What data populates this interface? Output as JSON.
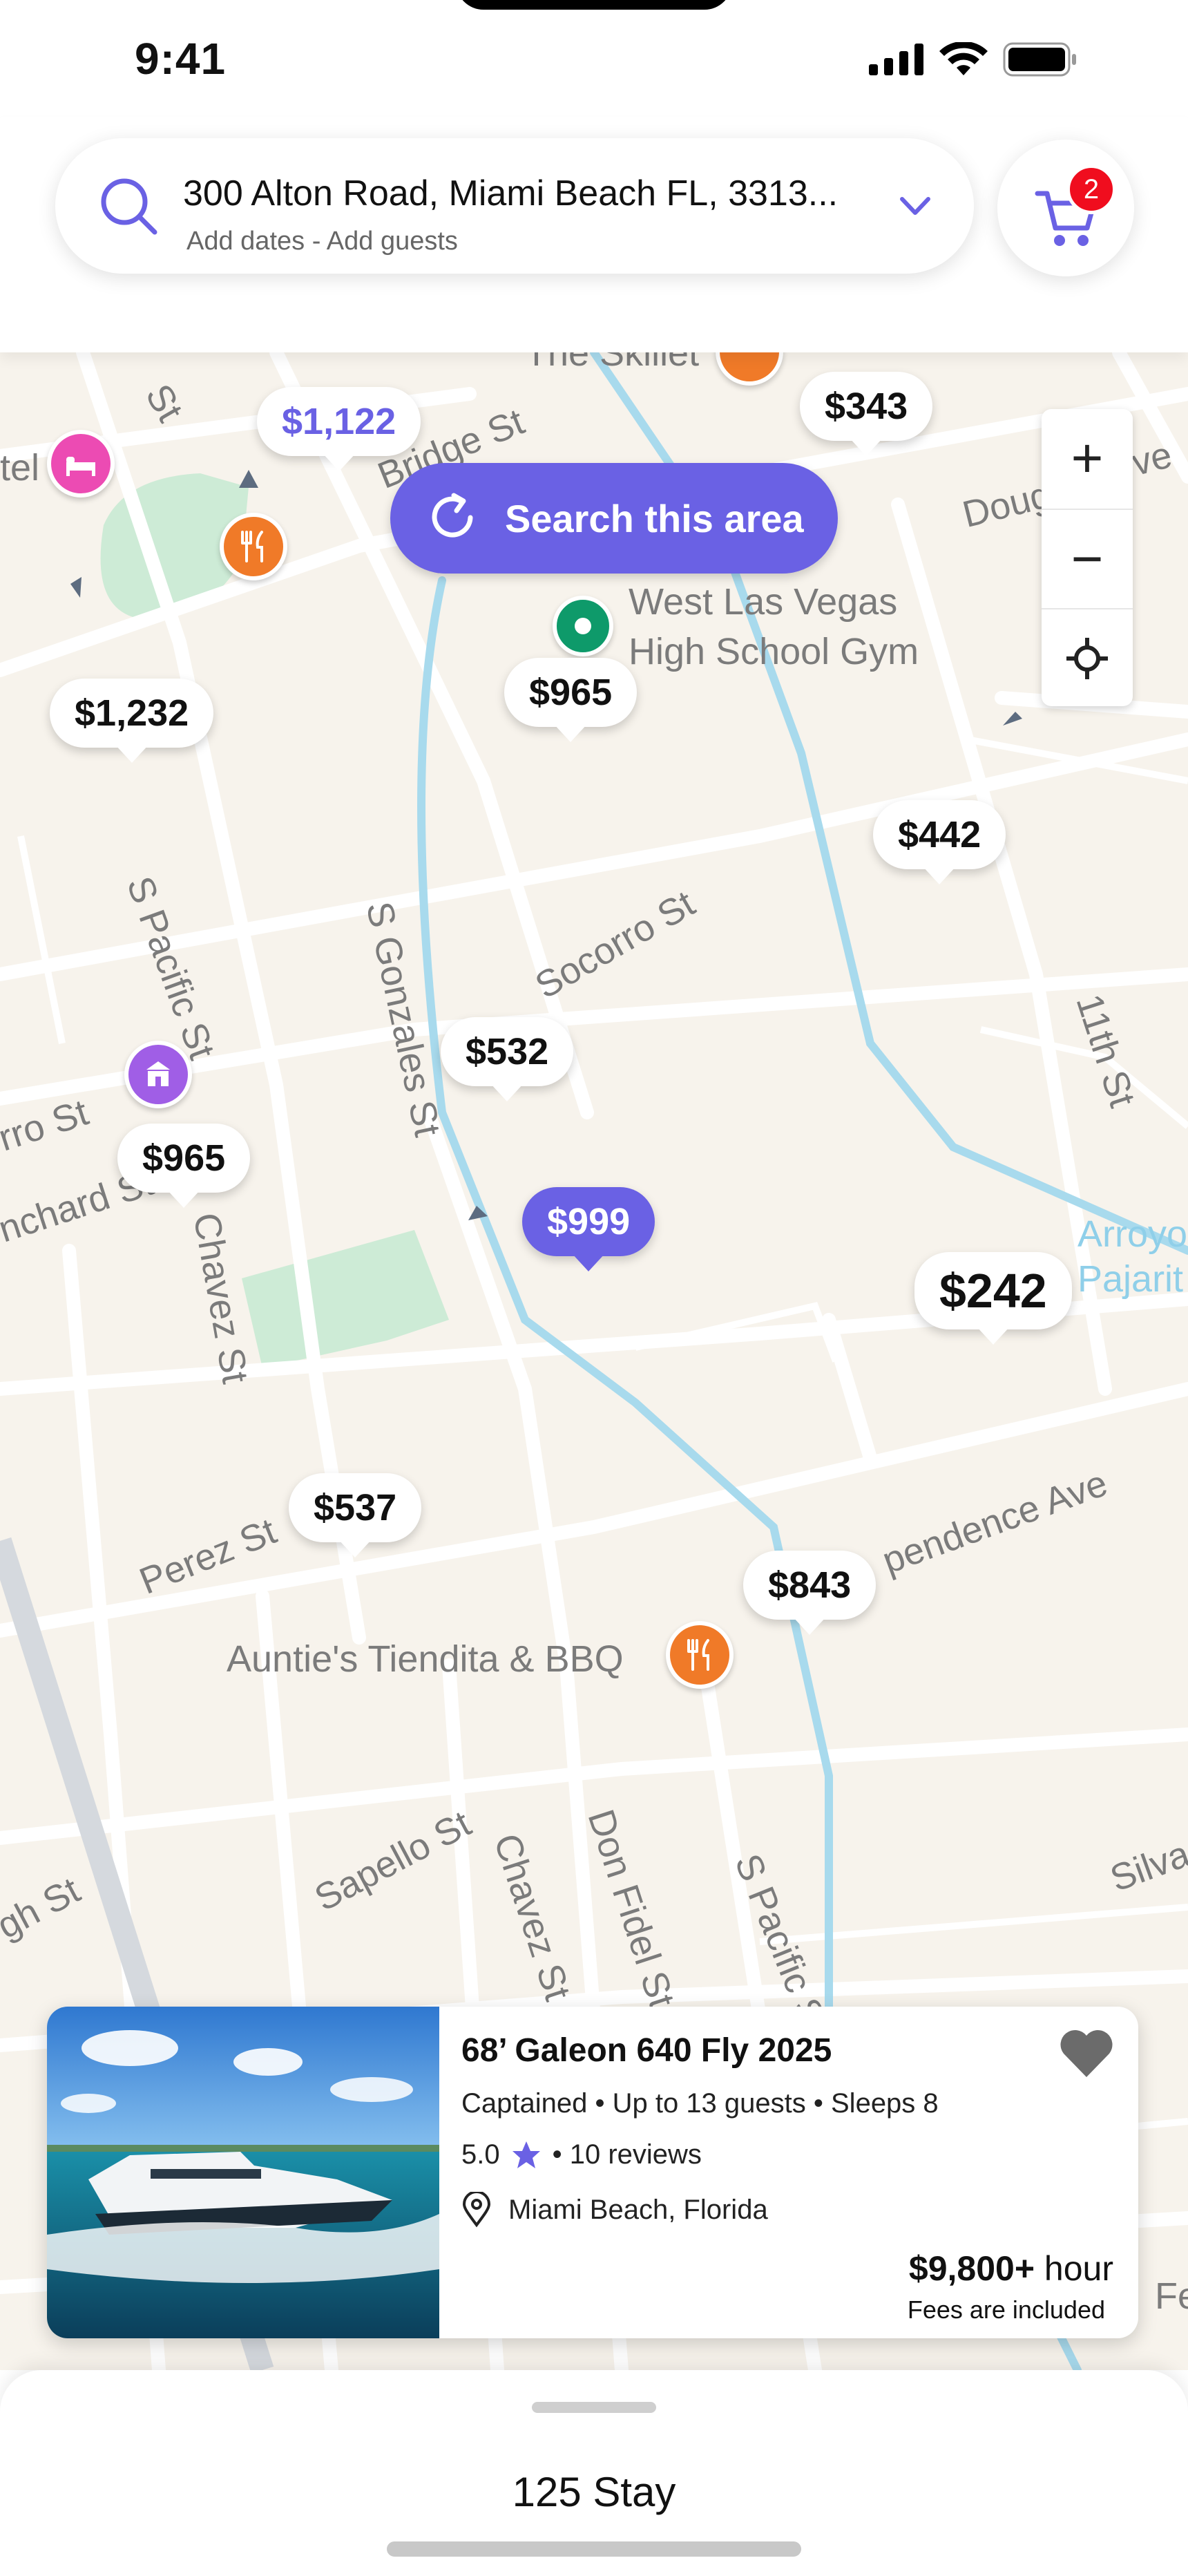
{
  "status_bar": {
    "time": "9:41"
  },
  "search": {
    "address": "300 Alton Road, Miami Beach FL, 3313...",
    "sub": "Add dates - Add guests"
  },
  "cart": {
    "badge_count": "2"
  },
  "map": {
    "search_area_label": "Search this area",
    "labels": {
      "skillet": "The Skillet",
      "bridge_st": "Bridge St",
      "tel": "tel",
      "douglas": "Doug",
      "douglas_ve": "ve",
      "gym_line1": "West Las Vegas",
      "gym_line2": "High School Gym",
      "s_pacific_upper": "S Pacific St",
      "s_gonzales": "S Gonzales St",
      "socorro": "Socorro St",
      "eleventh": "11th St",
      "rro_st": "rro St",
      "nchard": "nchard St",
      "chavez_upper": "Chavez St",
      "arroyo1": "Arroyo",
      "arroyo2": "Pajarit",
      "perez": "Perez St",
      "independence": "pendence Ave",
      "aunties": "Auntie's Tiendita & BBQ",
      "sapello": "Sapello St",
      "chavez_lower": "Chavez St",
      "don_fidel": "Don Fidel St",
      "s_pacific_lower": "S Pacific St",
      "gh_st": "gh St",
      "silva": "Silva",
      "st_top": "St",
      "fe": "Fe"
    },
    "prices": [
      {
        "id": "p1122",
        "label": "$1,122",
        "state": "visited"
      },
      {
        "id": "p343",
        "label": "$343",
        "state": "default"
      },
      {
        "id": "p1232",
        "label": "$1,232",
        "state": "default"
      },
      {
        "id": "p965a",
        "label": "$965",
        "state": "default"
      },
      {
        "id": "p442",
        "label": "$442",
        "state": "default"
      },
      {
        "id": "p532",
        "label": "$532",
        "state": "default"
      },
      {
        "id": "p965b",
        "label": "$965",
        "state": "default"
      },
      {
        "id": "p999",
        "label": "$999",
        "state": "active"
      },
      {
        "id": "p242",
        "label": "$242",
        "state": "default"
      },
      {
        "id": "p537",
        "label": "$537",
        "state": "default"
      },
      {
        "id": "p843",
        "label": "$843",
        "state": "default"
      }
    ],
    "zoom": {
      "in": "+",
      "out": "−"
    },
    "colors": {
      "accent": "#6a61e4",
      "poi_food": "#f07a28",
      "poi_hotel": "#ec4bb3",
      "poi_landmark": "#a05ee6",
      "poi_place": "#0e9a6a",
      "water": "#a8daed",
      "park": "#cdebd6"
    }
  },
  "listing": {
    "title": "68’ Galeon 640 Fly  2025",
    "meta": "Captained  •  Up to 13 guests  • Sleeps 8",
    "rating": "5.0",
    "reviews": "•  10 reviews",
    "location": "Miami Beach, Florida",
    "price_amount": "$9,800+",
    "price_unit": " hour",
    "fees": "Fees are included"
  },
  "sheet": {
    "title": "125 Stay"
  }
}
